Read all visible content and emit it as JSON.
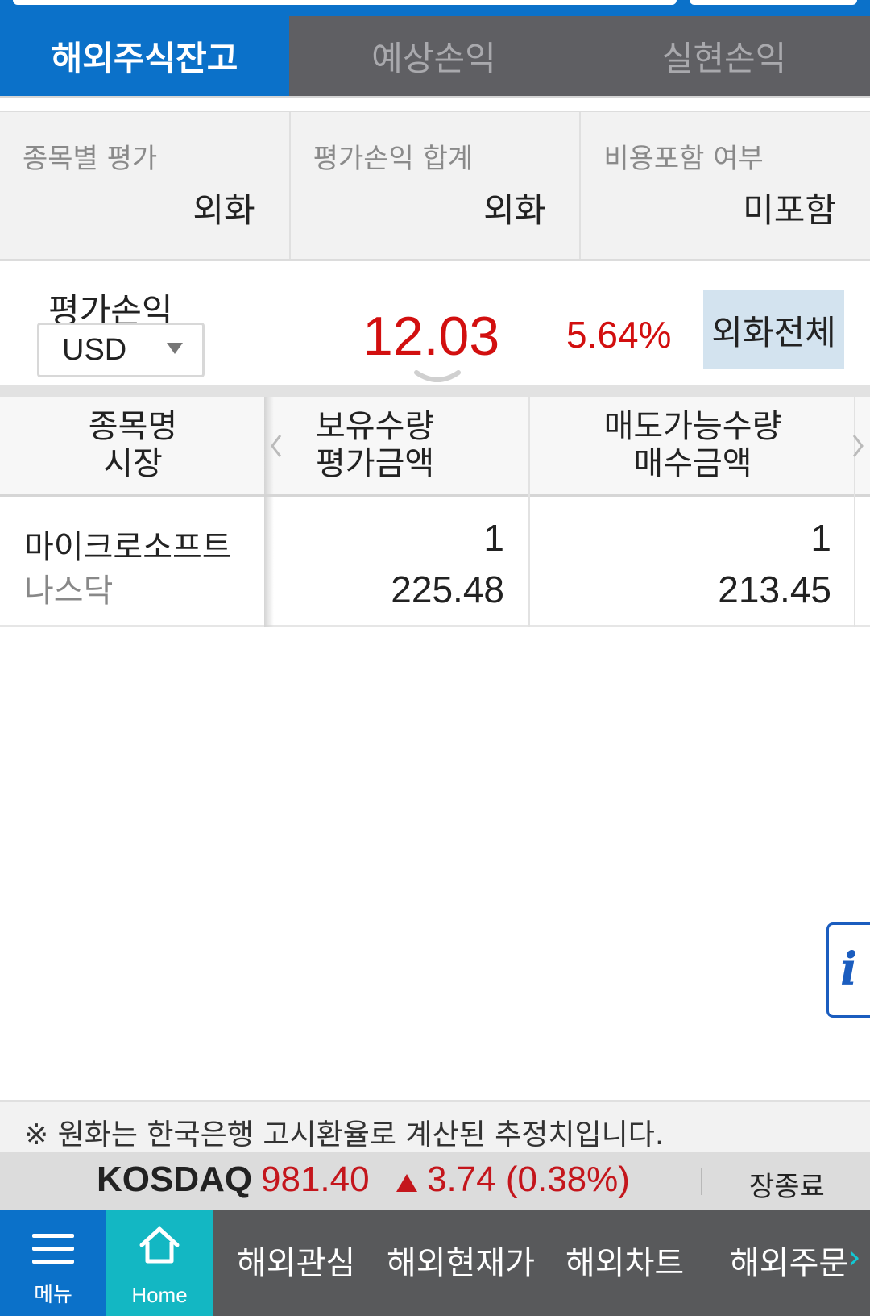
{
  "tabs": [
    {
      "label": "해외주식잔고",
      "active": true
    },
    {
      "label": "예상손익",
      "active": false
    },
    {
      "label": "실현손익",
      "active": false
    }
  ],
  "options": [
    {
      "label": "종목별 평가",
      "value": "외화"
    },
    {
      "label": "평가손익 합계",
      "value": "외화"
    },
    {
      "label": "비용포함 여부",
      "value": "미포함"
    }
  ],
  "summary": {
    "label": "평가손익",
    "currency": "USD",
    "amount": "12.03",
    "rate": "5.64%",
    "all_button": "외화전체"
  },
  "table": {
    "headers": [
      [
        "종목명",
        "시장"
      ],
      [
        "보유수량",
        "평가금액"
      ],
      [
        "매도가능수량",
        "매수금액"
      ]
    ],
    "rows": [
      {
        "name": "마이크로소프트",
        "market": "나스닥",
        "qty": "1",
        "eval": "225.48",
        "sellable": "1",
        "buy": "213.45"
      }
    ]
  },
  "notice": "※ 원화는 한국은행 고시환율로 계산된 추정치입니다.",
  "ticker": {
    "name": "KOSDAQ",
    "value": "981.40",
    "change": "3.74 (0.38%)",
    "status": "장종료",
    "color_up": "#c4161c"
  },
  "nav": {
    "menu": "메뉴",
    "home": "Home",
    "items": [
      "해외관심",
      "해외현재가",
      "해외차트",
      "해외주문"
    ]
  },
  "colors": {
    "brand_blue": "#0b71c9",
    "home_teal": "#13b7c3",
    "profit_red": "#d20f0f"
  },
  "icons": [
    "dropdown-arrow-icon",
    "chevron-left-icon",
    "chevron-right-icon",
    "info-icon",
    "menu-icon",
    "home-icon",
    "next-icon",
    "up-triangle-icon"
  ]
}
